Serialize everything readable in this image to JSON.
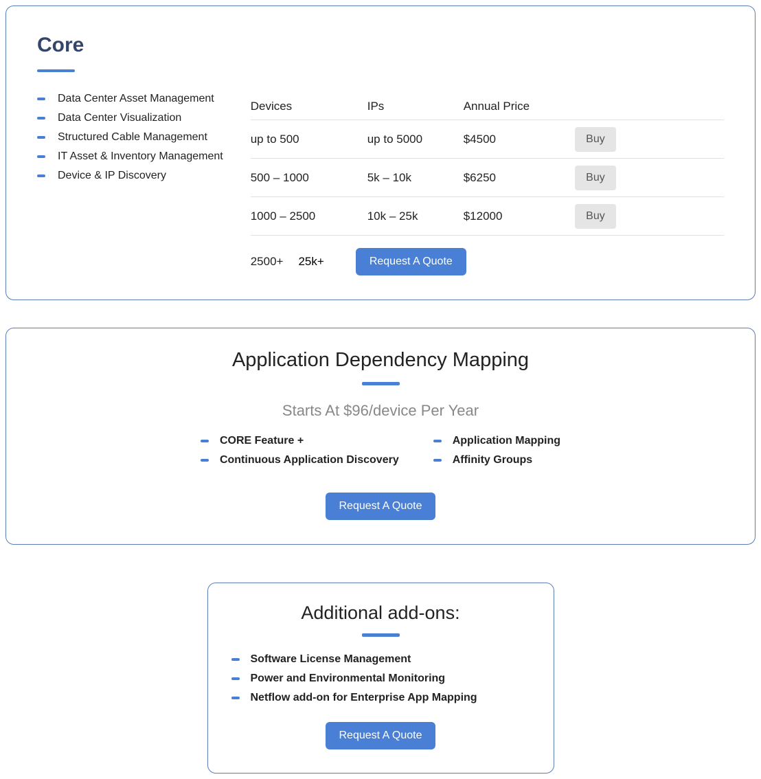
{
  "core": {
    "title": "Core",
    "features": [
      "Data Center Asset Management",
      "Data Center Visualization",
      "Structured Cable Management",
      "IT Asset & Inventory Management",
      "Device & IP Discovery"
    ],
    "columns": {
      "devices": "Devices",
      "ips": "IPs",
      "price": "Annual Price"
    },
    "tiers": [
      {
        "devices": "up to 500",
        "ips": "up to 5000",
        "price": "$4500",
        "buy": "Buy"
      },
      {
        "devices": "500 – 1000",
        "ips": "5k – 10k",
        "price": "$6250",
        "buy": "Buy"
      },
      {
        "devices": "1000 – 2500",
        "ips": "10k – 25k",
        "price": "$12000",
        "buy": "Buy"
      }
    ],
    "overflow": {
      "devices": "2500+",
      "ips": "25k+",
      "quote": "Request A Quote"
    }
  },
  "adm": {
    "title": "Application Dependency Mapping",
    "subtitle": "Starts At $96/device Per Year",
    "features_left": [
      "CORE Feature +",
      "Continuous Application Discovery"
    ],
    "features_right": [
      "Application Mapping",
      "Affinity Groups"
    ],
    "quote": "Request A Quote"
  },
  "addons": {
    "title": "Additional add-ons:",
    "features": [
      "Software License Management",
      "Power and Environmental Monitoring",
      "Netflow add-on for Enterprise App Mapping"
    ],
    "quote": "Request A Quote"
  }
}
